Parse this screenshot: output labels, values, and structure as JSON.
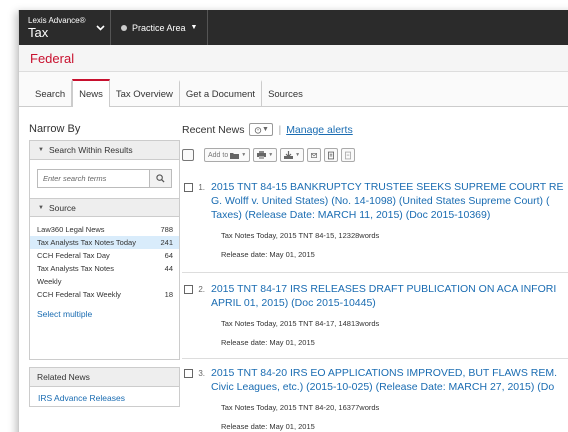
{
  "header": {
    "brand_small": "Lexis Advance®",
    "brand_big": "Tax",
    "practice_label": "Practice Area"
  },
  "section_title": "Federal",
  "tabs": [
    {
      "label": "Search"
    },
    {
      "label": "News",
      "active": true
    },
    {
      "label": "Tax Overview"
    },
    {
      "label": "Get a Document"
    },
    {
      "label": "Sources"
    }
  ],
  "sidebar": {
    "narrow_by": "Narrow By",
    "search_within_label": "Search Within Results",
    "search_placeholder": "Enter search terms",
    "source_label": "Source",
    "sources": [
      {
        "name": "Law360 Legal News",
        "count": "788"
      },
      {
        "name": "Tax Analysts Tax Notes Today",
        "count": "241"
      },
      {
        "name": "CCH Federal Tax Day",
        "count": "64"
      },
      {
        "name": "Tax Analysts Tax Notes",
        "count": "44"
      },
      {
        "name": "Weekly",
        "count": ""
      },
      {
        "name": "CCH Federal Tax Weekly",
        "count": "18"
      }
    ],
    "select_multiple": "Select multiple",
    "related_news_label": "Related News",
    "related_link": "IRS Advance Releases"
  },
  "main": {
    "recent_news": "Recent News",
    "manage_alerts": "Manage alerts",
    "add_to_label": "Add to",
    "results": [
      {
        "num": "1.",
        "line1": "2015 TNT 84-15 BANKRUPTCY TRUSTEE SEEKS SUPREME COURT RE",
        "line2": "G. Wolff v. United States) (No. 14-1098) (United States Supreme Court) (",
        "line3": "Taxes) (Release Date: MARCH 11, 2015) (Doc 2015-10369)",
        "meta": "Tax Notes Today, 2015 TNT 84-15, 12328words",
        "date": "Release date: May 01, 2015"
      },
      {
        "num": "2.",
        "line1": "2015 TNT 84-17 IRS RELEASES DRAFT PUBLICATION ON ACA INFORI",
        "line2": "APRIL 01, 2015) (Doc 2015-10445)",
        "meta": "Tax Notes Today, 2015 TNT 84-17, 14813words",
        "date": "Release date: May 01, 2015"
      },
      {
        "num": "3.",
        "line1": "2015 TNT 84-20 IRS EO APPLICATIONS IMPROVED, BUT FLAWS REM.",
        "line2": "Civic Leagues, etc.) (2015-10-025) (Release Date: MARCH 27, 2015) (Do",
        "meta": "Tax Notes Today, 2015 TNT 84-20, 16377words",
        "date": "Release date: May 01, 2015"
      }
    ]
  }
}
